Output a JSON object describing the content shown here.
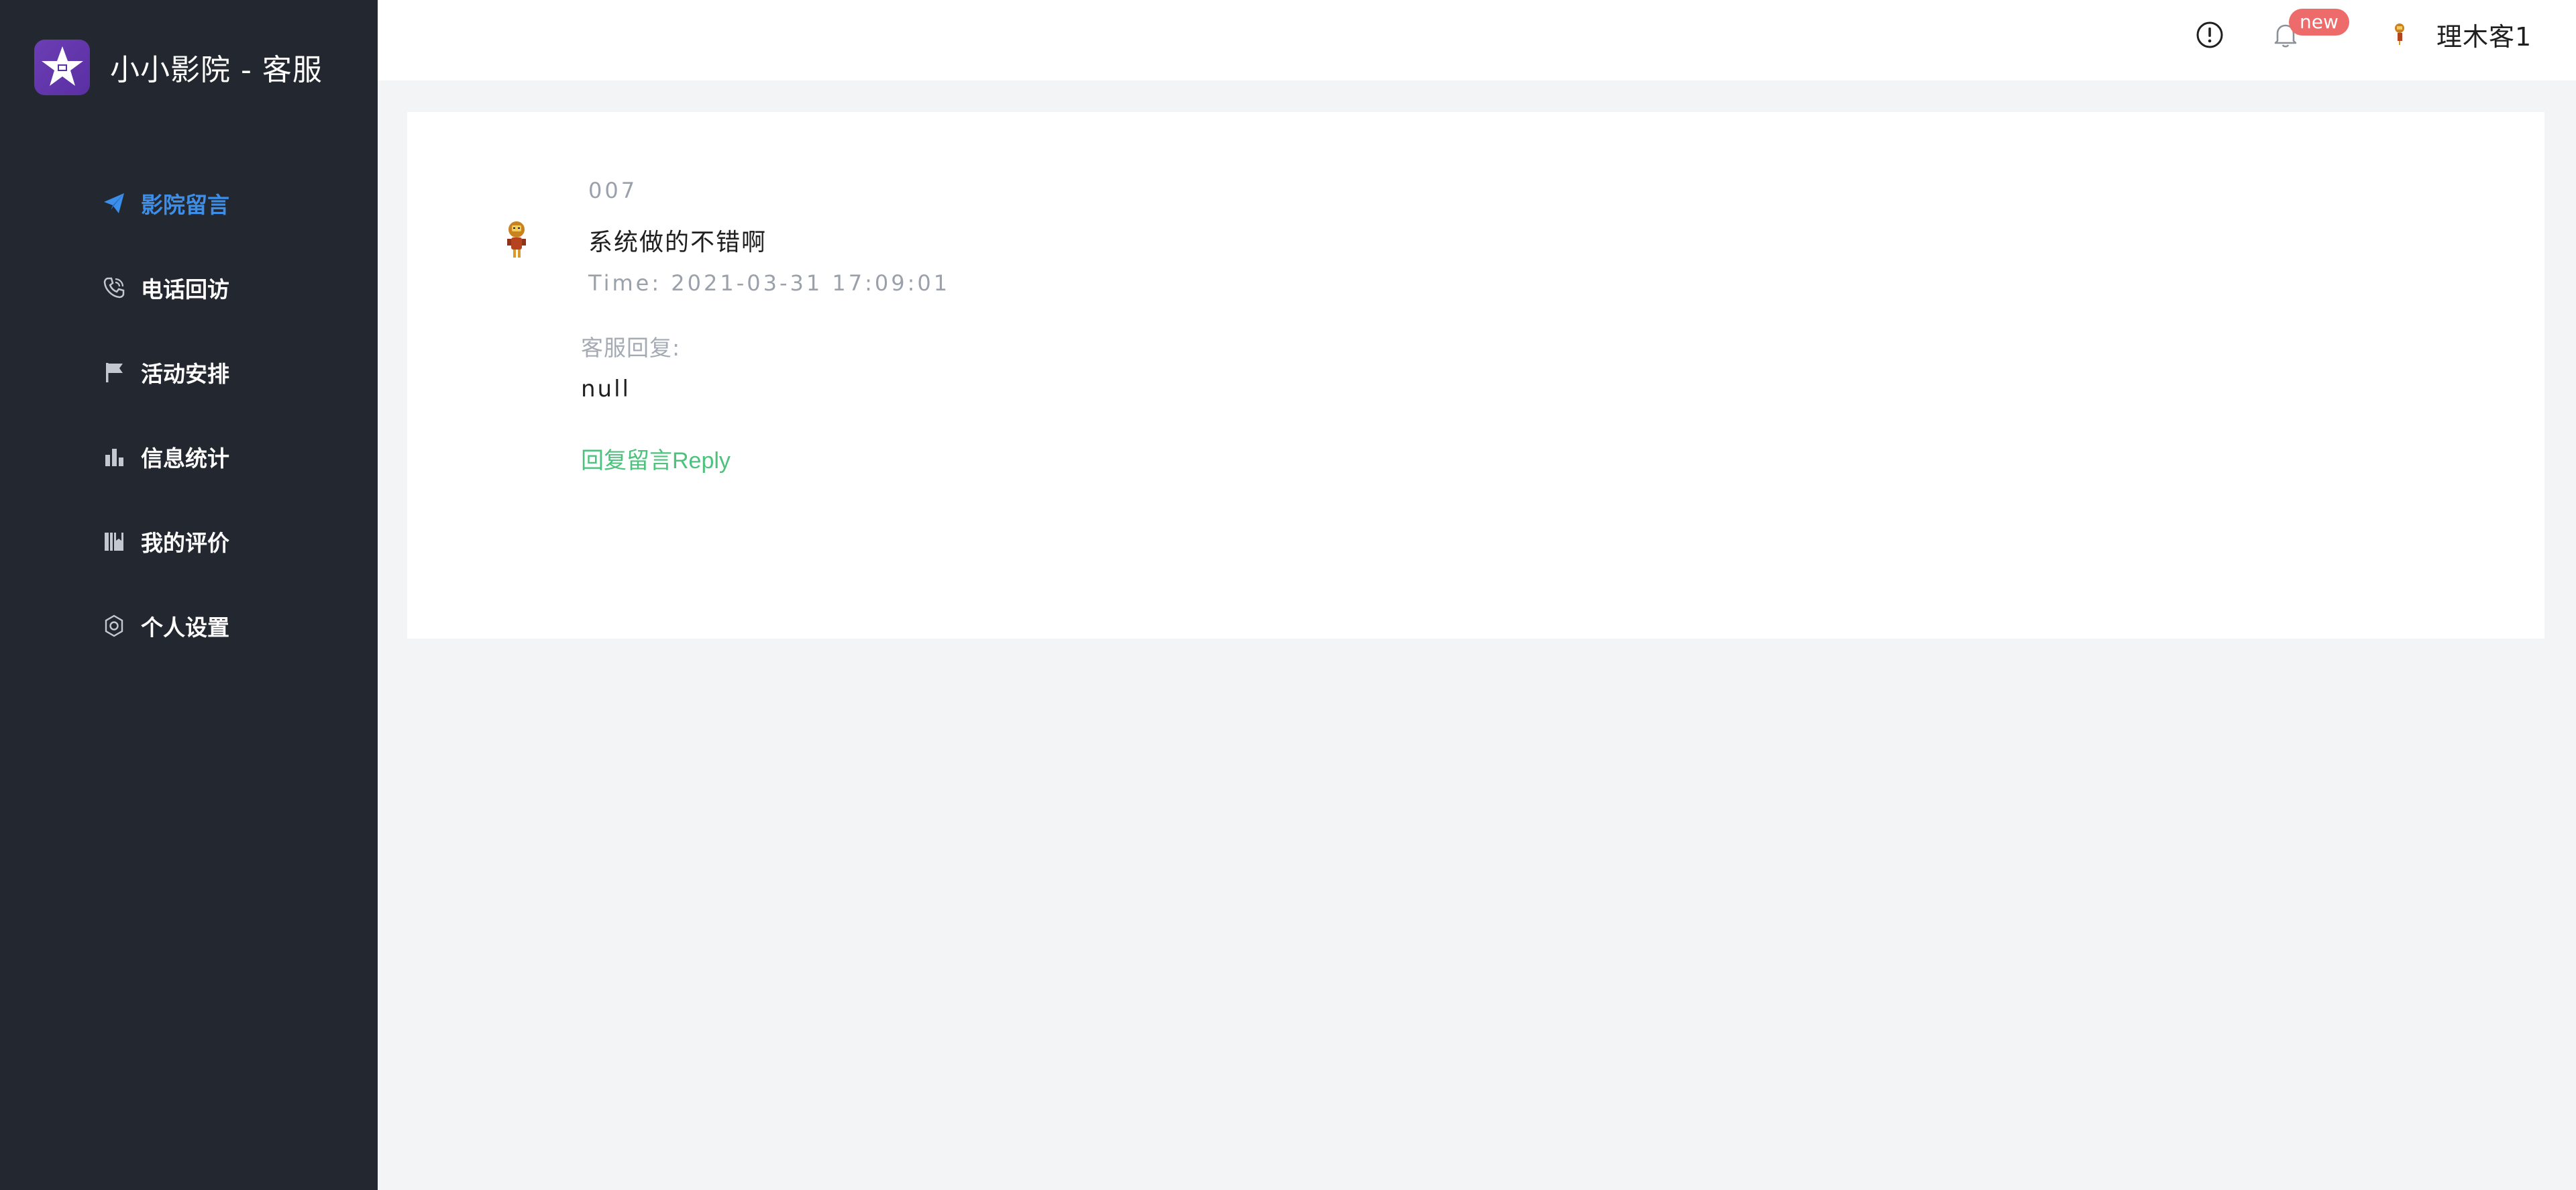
{
  "app": {
    "title": "小小影院 - 客服",
    "logo_icon": "star-logo-icon",
    "sidebar_bg": "#232830",
    "accent": "#3b8eea"
  },
  "sidebar": {
    "items": [
      {
        "label": "影院留言",
        "icon": "paper-plane-icon",
        "active": true
      },
      {
        "label": "电话回访",
        "icon": "phone-icon",
        "active": false
      },
      {
        "label": "活动安排",
        "icon": "flag-icon",
        "active": false
      },
      {
        "label": "信息统计",
        "icon": "bar-chart-icon",
        "active": false
      },
      {
        "label": "我的评价",
        "icon": "book-icon",
        "active": false
      },
      {
        "label": "个人设置",
        "icon": "gear-icon",
        "active": false
      }
    ]
  },
  "header": {
    "info_icon": "info-circle-icon",
    "bell_icon": "bell-icon",
    "badge": "new",
    "username": "理木客1"
  },
  "message": {
    "name": "007",
    "content": "系统做的不错啊",
    "time": "Time: 2021-03-31 17:09:01",
    "reply_label": "客服回复:",
    "reply_content": "null",
    "reply_link": "回复留言Reply"
  }
}
